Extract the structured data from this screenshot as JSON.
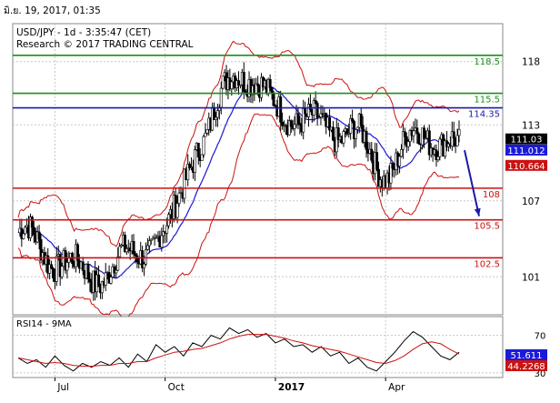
{
  "header": {
    "timestamp": "มิ.ย. 19, 2017, 01:35",
    "instrument_line": "USD/JPY - 1d - 3:35:47 (CET)",
    "copyright_line": "Research © 2017 TRADING CENTRAL"
  },
  "chart_data": [
    {
      "type": "candlestick",
      "title": "USD/JPY - 1d - 3:35:47 (CET)",
      "x_tick_labels": [
        "Jul",
        "Oct",
        "2017",
        "Apr"
      ],
      "y_tick_labels": [
        101,
        107,
        113,
        118
      ],
      "ylim": [
        98,
        121
      ],
      "grid": true,
      "price_series_anchors": {
        "dates": [
          "Jun 2016",
          "Jul 2016",
          "Aug 2016",
          "Sep 2016",
          "Oct 2016",
          "Nov 2016",
          "Dec 2016",
          "Jan 2017",
          "Feb 2017",
          "Mar 2017",
          "Apr 2017",
          "May 2017",
          "Jun 2017"
        ],
        "close": [
          104.5,
          102.5,
          101.0,
          102.5,
          104.5,
          112.0,
          117.5,
          114.5,
          113.0,
          112.5,
          109.5,
          112.5,
          111.0
        ]
      },
      "horizontal_levels": [
        {
          "value": 118.5,
          "label": "118.5",
          "color": "#1e8c1e"
        },
        {
          "value": 115.5,
          "label": "115.5",
          "color": "#1e8c1e"
        },
        {
          "value": 114.35,
          "label": "114.35",
          "color": "#1a1aa8"
        },
        {
          "value": 108,
          "label": "108",
          "color": "#cc1111"
        },
        {
          "value": 105.5,
          "label": "105.5",
          "color": "#cc1111"
        },
        {
          "value": 102.5,
          "label": "102.5",
          "color": "#cc1111"
        }
      ],
      "price_tags": [
        {
          "value": 111.03,
          "label": "111.03",
          "bg": "#000000",
          "fg": "#ffffff"
        },
        {
          "value": 111.012,
          "label": "111.012",
          "bg": "#1a1ad8",
          "fg": "#ffffff"
        },
        {
          "value": 110.664,
          "label": "110.664",
          "bg": "#cc1111",
          "fg": "#ffffff"
        }
      ],
      "projection_arrow": {
        "from": 111.0,
        "to": 105.5,
        "color": "#1a1aa8"
      }
    },
    {
      "type": "line",
      "title": "RSI14 - 9MA",
      "y_tick_labels": [
        30,
        70
      ],
      "ylim": [
        25,
        90
      ],
      "series": [
        {
          "values": [
            46,
            40,
            44,
            36,
            48,
            38,
            32,
            40,
            36,
            42,
            38,
            46,
            36,
            50,
            42,
            60,
            52,
            58,
            48,
            62,
            58,
            70,
            66,
            78,
            72,
            76,
            68,
            72,
            62,
            66,
            58,
            60,
            52,
            58,
            48,
            52,
            40,
            46,
            36,
            32,
            42,
            52,
            64,
            74,
            68,
            58,
            48,
            44,
            52
          ],
          "color": "#000000"
        },
        {
          "values": [
            46,
            44,
            42,
            40,
            41,
            40,
            38,
            37,
            37,
            38,
            38,
            40,
            40,
            42,
            42,
            46,
            49,
            52,
            53,
            55,
            56,
            59,
            62,
            66,
            69,
            71,
            71,
            71,
            69,
            67,
            64,
            62,
            59,
            57,
            55,
            53,
            50,
            47,
            44,
            41,
            40,
            43,
            48,
            55,
            61,
            63,
            61,
            55,
            50
          ],
          "color": "#cc1111"
        }
      ],
      "price_tags": [
        {
          "value": 51.611,
          "label": "51.611",
          "bg": "#1a1ad8",
          "fg": "#ffffff"
        },
        {
          "value": 44.2268,
          "label": "44.2268",
          "bg": "#cc1111",
          "fg": "#ffffff"
        }
      ]
    }
  ]
}
